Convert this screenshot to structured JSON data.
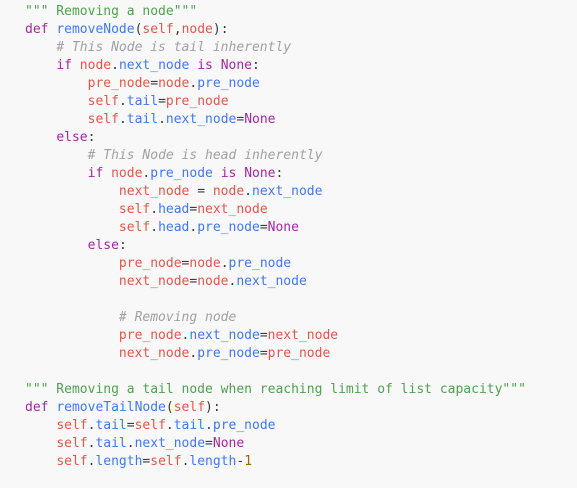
{
  "editor": {
    "lines": [
      [
        {
          "t": "\"\"\" Removing a node\"\"\"",
          "c": "str"
        }
      ],
      [
        {
          "t": "def",
          "c": "kw"
        },
        {
          "t": " ",
          "c": "op"
        },
        {
          "t": "removeNode",
          "c": "fn"
        },
        {
          "t": "(",
          "c": "op"
        },
        {
          "t": "self",
          "c": "var"
        },
        {
          "t": ",",
          "c": "op"
        },
        {
          "t": "node",
          "c": "var"
        },
        {
          "t": "):",
          "c": "op"
        }
      ],
      [
        {
          "t": "    ",
          "c": "op"
        },
        {
          "t": "# This Node is tail inherently",
          "c": "com"
        }
      ],
      [
        {
          "t": "    ",
          "c": "op"
        },
        {
          "t": "if",
          "c": "kw"
        },
        {
          "t": " ",
          "c": "op"
        },
        {
          "t": "node",
          "c": "var"
        },
        {
          "t": ".",
          "c": "op"
        },
        {
          "t": "next_node",
          "c": "attr"
        },
        {
          "t": " ",
          "c": "op"
        },
        {
          "t": "is",
          "c": "kw"
        },
        {
          "t": " ",
          "c": "op"
        },
        {
          "t": "None",
          "c": "none"
        },
        {
          "t": ":",
          "c": "op"
        }
      ],
      [
        {
          "t": "        ",
          "c": "op"
        },
        {
          "t": "pre_node",
          "c": "var"
        },
        {
          "t": "=",
          "c": "op"
        },
        {
          "t": "node",
          "c": "var"
        },
        {
          "t": ".",
          "c": "op"
        },
        {
          "t": "pre_node",
          "c": "attr"
        }
      ],
      [
        {
          "t": "        ",
          "c": "op"
        },
        {
          "t": "self",
          "c": "var"
        },
        {
          "t": ".",
          "c": "op"
        },
        {
          "t": "tail",
          "c": "attr"
        },
        {
          "t": "=",
          "c": "op"
        },
        {
          "t": "pre_node",
          "c": "var"
        }
      ],
      [
        {
          "t": "        ",
          "c": "op"
        },
        {
          "t": "self",
          "c": "var"
        },
        {
          "t": ".",
          "c": "op"
        },
        {
          "t": "tail",
          "c": "attr"
        },
        {
          "t": ".",
          "c": "op"
        },
        {
          "t": "next_node",
          "c": "attr"
        },
        {
          "t": "=",
          "c": "op"
        },
        {
          "t": "None",
          "c": "none"
        }
      ],
      [
        {
          "t": "    ",
          "c": "op"
        },
        {
          "t": "else",
          "c": "kw"
        },
        {
          "t": ":",
          "c": "op"
        }
      ],
      [
        {
          "t": "        ",
          "c": "op"
        },
        {
          "t": "# This Node is head inherently",
          "c": "com"
        }
      ],
      [
        {
          "t": "        ",
          "c": "op"
        },
        {
          "t": "if",
          "c": "kw"
        },
        {
          "t": " ",
          "c": "op"
        },
        {
          "t": "node",
          "c": "var"
        },
        {
          "t": ".",
          "c": "op"
        },
        {
          "t": "pre_node",
          "c": "attr"
        },
        {
          "t": " ",
          "c": "op"
        },
        {
          "t": "is",
          "c": "kw"
        },
        {
          "t": " ",
          "c": "op"
        },
        {
          "t": "None",
          "c": "none"
        },
        {
          "t": ":",
          "c": "op"
        }
      ],
      [
        {
          "t": "            ",
          "c": "op"
        },
        {
          "t": "next_node",
          "c": "var"
        },
        {
          "t": " = ",
          "c": "op"
        },
        {
          "t": "node",
          "c": "var"
        },
        {
          "t": ".",
          "c": "op"
        },
        {
          "t": "next_node",
          "c": "attr"
        }
      ],
      [
        {
          "t": "            ",
          "c": "op"
        },
        {
          "t": "self",
          "c": "var"
        },
        {
          "t": ".",
          "c": "op"
        },
        {
          "t": "head",
          "c": "attr"
        },
        {
          "t": "=",
          "c": "op"
        },
        {
          "t": "next_node",
          "c": "var"
        }
      ],
      [
        {
          "t": "            ",
          "c": "op"
        },
        {
          "t": "self",
          "c": "var"
        },
        {
          "t": ".",
          "c": "op"
        },
        {
          "t": "head",
          "c": "attr"
        },
        {
          "t": ".",
          "c": "op"
        },
        {
          "t": "pre_node",
          "c": "attr"
        },
        {
          "t": "=",
          "c": "op"
        },
        {
          "t": "None",
          "c": "none"
        }
      ],
      [
        {
          "t": "        ",
          "c": "op"
        },
        {
          "t": "else",
          "c": "kw"
        },
        {
          "t": ":",
          "c": "op"
        }
      ],
      [
        {
          "t": "            ",
          "c": "op"
        },
        {
          "t": "pre_node",
          "c": "var"
        },
        {
          "t": "=",
          "c": "op"
        },
        {
          "t": "node",
          "c": "var"
        },
        {
          "t": ".",
          "c": "op"
        },
        {
          "t": "pre_node",
          "c": "attr"
        }
      ],
      [
        {
          "t": "            ",
          "c": "op"
        },
        {
          "t": "next_node",
          "c": "var"
        },
        {
          "t": "=",
          "c": "op"
        },
        {
          "t": "node",
          "c": "var"
        },
        {
          "t": ".",
          "c": "op"
        },
        {
          "t": "next_node",
          "c": "attr"
        }
      ],
      [],
      [
        {
          "t": "            ",
          "c": "op"
        },
        {
          "t": "# Removing node",
          "c": "com"
        }
      ],
      [
        {
          "t": "            ",
          "c": "op"
        },
        {
          "t": "pre_node",
          "c": "var"
        },
        {
          "t": ".",
          "c": "op"
        },
        {
          "t": "next_node",
          "c": "attr"
        },
        {
          "t": "=",
          "c": "op"
        },
        {
          "t": "next_node",
          "c": "var"
        }
      ],
      [
        {
          "t": "            ",
          "c": "op"
        },
        {
          "t": "next_node",
          "c": "var"
        },
        {
          "t": ".",
          "c": "op"
        },
        {
          "t": "pre_node",
          "c": "attr"
        },
        {
          "t": "=",
          "c": "op"
        },
        {
          "t": "pre_node",
          "c": "var"
        }
      ],
      [],
      [
        {
          "t": "\"\"\" Removing a tail node when reaching limit of list capacity\"\"\"",
          "c": "str"
        }
      ],
      [
        {
          "t": "def",
          "c": "kw"
        },
        {
          "t": " ",
          "c": "op"
        },
        {
          "t": "removeTailNode",
          "c": "fn"
        },
        {
          "t": "(",
          "c": "op"
        },
        {
          "t": "self",
          "c": "var"
        },
        {
          "t": "):",
          "c": "op"
        }
      ],
      [
        {
          "t": "    ",
          "c": "op"
        },
        {
          "t": "self",
          "c": "var"
        },
        {
          "t": ".",
          "c": "op"
        },
        {
          "t": "tail",
          "c": "attr"
        },
        {
          "t": "=",
          "c": "op"
        },
        {
          "t": "self",
          "c": "var"
        },
        {
          "t": ".",
          "c": "op"
        },
        {
          "t": "tail",
          "c": "attr"
        },
        {
          "t": ".",
          "c": "op"
        },
        {
          "t": "pre_node",
          "c": "attr"
        }
      ],
      [
        {
          "t": "    ",
          "c": "op"
        },
        {
          "t": "self",
          "c": "var"
        },
        {
          "t": ".",
          "c": "op"
        },
        {
          "t": "tail",
          "c": "attr"
        },
        {
          "t": ".",
          "c": "op"
        },
        {
          "t": "next_node",
          "c": "attr"
        },
        {
          "t": "=",
          "c": "op"
        },
        {
          "t": "None",
          "c": "none"
        }
      ],
      [
        {
          "t": "    ",
          "c": "op"
        },
        {
          "t": "self",
          "c": "var"
        },
        {
          "t": ".",
          "c": "op"
        },
        {
          "t": "length",
          "c": "attr"
        },
        {
          "t": "=",
          "c": "op"
        },
        {
          "t": "self",
          "c": "var"
        },
        {
          "t": ".",
          "c": "op"
        },
        {
          "t": "length",
          "c": "attr"
        },
        {
          "t": "-",
          "c": "op"
        },
        {
          "t": "1",
          "c": "num"
        }
      ]
    ]
  },
  "colors": {
    "background": "#f8f8f8",
    "string": "#50a14f",
    "keyword": "#a626a4",
    "function": "#4078f2",
    "variable": "#e45649",
    "comment": "#a0a1a7",
    "number": "#986801"
  }
}
